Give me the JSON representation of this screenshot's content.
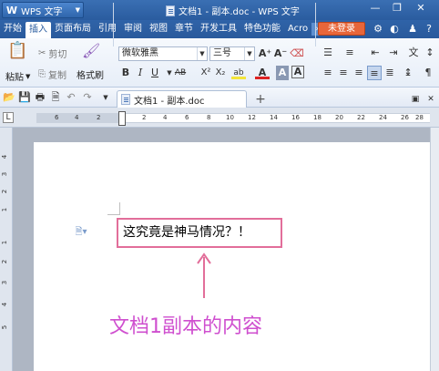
{
  "app": {
    "name": "WPS 文字",
    "window_title": "文档1 - 副本.doc - WPS 文字"
  },
  "menu": {
    "items": [
      "开始",
      "插入",
      "页面布局",
      "引用",
      "审阅",
      "视图",
      "章节",
      "开发工具",
      "特色功能",
      "Acro"
    ],
    "more": "›",
    "login": "未登录"
  },
  "ribbon": {
    "paste": "粘贴",
    "cut": "剪切",
    "copy": "复制",
    "format_painter": "格式刷",
    "font_name": "微软雅黑",
    "font_size": "三号"
  },
  "tabs": {
    "doc_tab": "文档1 - 副本.doc",
    "add": "+"
  },
  "ruler": {
    "h_numbers": [
      "6",
      "4",
      "2",
      "2",
      "4",
      "6",
      "8",
      "10",
      "12",
      "14",
      "16",
      "18",
      "20",
      "22",
      "24",
      "26",
      "28"
    ],
    "v_numbers": [
      "4",
      "3",
      "2",
      "1",
      "1",
      "2",
      "3",
      "4",
      "5"
    ]
  },
  "document": {
    "text": "这究竟是神马情况？！"
  },
  "annotation": {
    "text": "文档1副本的内容",
    "color": "#cf4fcf",
    "box_color": "#e26e9a"
  },
  "colors": {
    "titlebar": "#2a5c9f",
    "login_button": "#e8663a"
  }
}
